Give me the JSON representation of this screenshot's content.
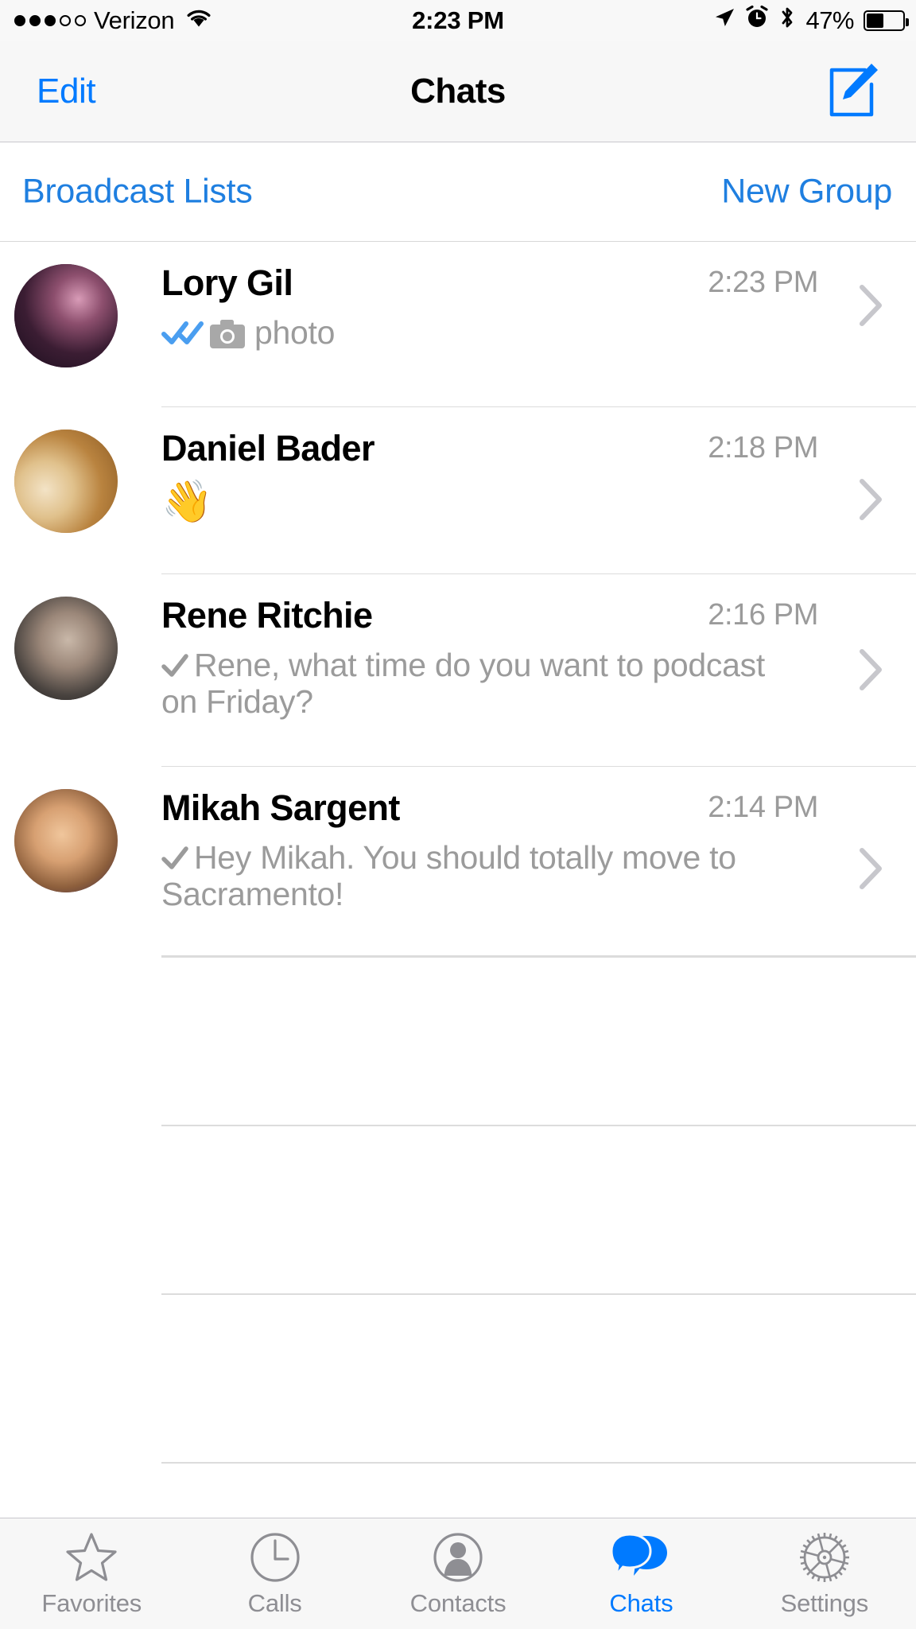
{
  "status_bar": {
    "signal_dots_filled": 3,
    "signal_dots_total": 5,
    "carrier": "Verizon",
    "wifi_icon": "wifi-icon",
    "time": "2:23 PM",
    "location_icon": "location-arrow-icon",
    "alarm_icon": "alarm-clock-icon",
    "bluetooth_icon": "bluetooth-icon",
    "battery_percent": "47%",
    "battery_level": 47
  },
  "nav_bar": {
    "left_button": "Edit",
    "title": "Chats",
    "right_icon": "compose-icon"
  },
  "broadcast_bar": {
    "left_label": "Broadcast Lists",
    "right_label": "New Group"
  },
  "chats": [
    {
      "name": "Lory Gil",
      "time": "2:23 PM",
      "status_icon": "double-check-icon",
      "status_color": "#4a9ef0",
      "attachment_icon": "camera-icon",
      "preview": "photo",
      "avatar": "lory-gil-avatar",
      "chevron": "chevron-right-icon"
    },
    {
      "name": "Daniel Bader",
      "time": "2:18 PM",
      "status_icon": "none",
      "status_color": "",
      "attachment_icon": "none",
      "preview": "👋",
      "is_emoji": true,
      "avatar": "daniel-bader-avatar",
      "chevron": "chevron-right-icon"
    },
    {
      "name": "Rene Ritchie",
      "time": "2:16 PM",
      "status_icon": "single-check-icon",
      "status_color": "#9b9b9b",
      "attachment_icon": "none",
      "preview": "Rene, what time do you want to podcast on Friday?",
      "avatar": "rene-ritchie-avatar",
      "chevron": "chevron-right-icon"
    },
    {
      "name": "Mikah Sargent",
      "time": "2:14 PM",
      "status_icon": "single-check-icon",
      "status_color": "#9b9b9b",
      "attachment_icon": "none",
      "preview": "Hey Mikah. You should totally move to Sacramento!",
      "avatar": "mikah-sargent-avatar",
      "chevron": "chevron-right-icon"
    }
  ],
  "empty_rows": 4,
  "tab_bar": {
    "active_index": 3,
    "accent_color": "#007aff",
    "inactive_color": "#8e8e93",
    "tabs": [
      {
        "label": "Favorites",
        "icon": "star-icon"
      },
      {
        "label": "Calls",
        "icon": "clock-icon"
      },
      {
        "label": "Contacts",
        "icon": "person-icon"
      },
      {
        "label": "Chats",
        "icon": "chat-bubbles-icon"
      },
      {
        "label": "Settings",
        "icon": "gear-icon"
      }
    ]
  },
  "colors": {
    "tint_blue": "#007aff",
    "link_blue": "#1f7fe0",
    "bar_background": "#f7f7f7",
    "separator": "#dcdcdc",
    "secondary_text": "#9b9b9b"
  }
}
